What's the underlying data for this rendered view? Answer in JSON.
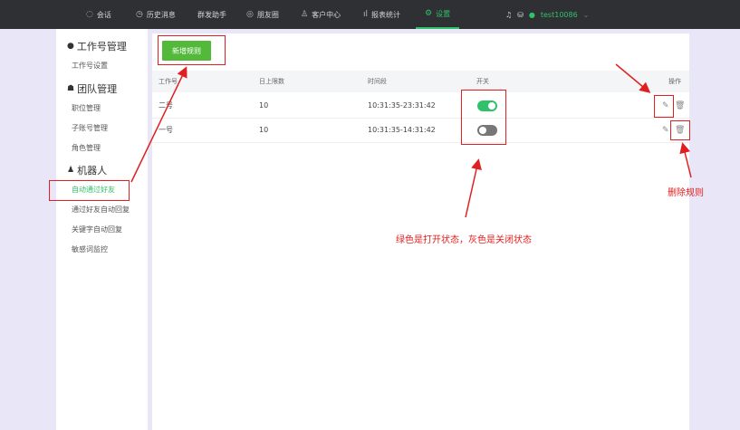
{
  "topnav": {
    "items": [
      {
        "label": "会话",
        "icon": "chat-icon"
      },
      {
        "label": "历史消息",
        "icon": "clock-icon"
      },
      {
        "label": "群发助手",
        "icon": ""
      },
      {
        "label": "朋友圈",
        "icon": "moments-icon"
      },
      {
        "label": "客户中心",
        "icon": "user-icon"
      },
      {
        "label": "报表统计",
        "icon": "chart-icon"
      },
      {
        "label": "设置",
        "icon": "settings-icon",
        "active": true
      }
    ],
    "user": "test10086"
  },
  "sidebar": {
    "group1": "工作号管理",
    "group1_items": [
      "工作号设置"
    ],
    "group2": "团队管理",
    "group2_items": [
      "职位管理",
      "子账号管理",
      "角色管理"
    ],
    "group3": "机器人",
    "group3_items": [
      "自动通过好友",
      "通过好友自动回复",
      "关键字自动回复",
      "敏感词监控"
    ]
  },
  "main": {
    "new_rule_button": "新增规则",
    "columns": [
      "工作号",
      "日上限数",
      "时间段",
      "开关",
      "操作"
    ],
    "rows": [
      {
        "name": "二号",
        "limit": "10",
        "time": "10:31:35-23:31:42",
        "switch": "on"
      },
      {
        "name": "一号",
        "limit": "10",
        "time": "10:31:35-14:31:42",
        "switch": "off"
      }
    ]
  },
  "annotations": {
    "delete_rule": "删除规则",
    "switch_explain": "绿色是打开状态，灰色是关闭状态"
  },
  "colors": {
    "accent": "#2fc26a",
    "button": "#52b93a",
    "annotation": "#e02020"
  }
}
